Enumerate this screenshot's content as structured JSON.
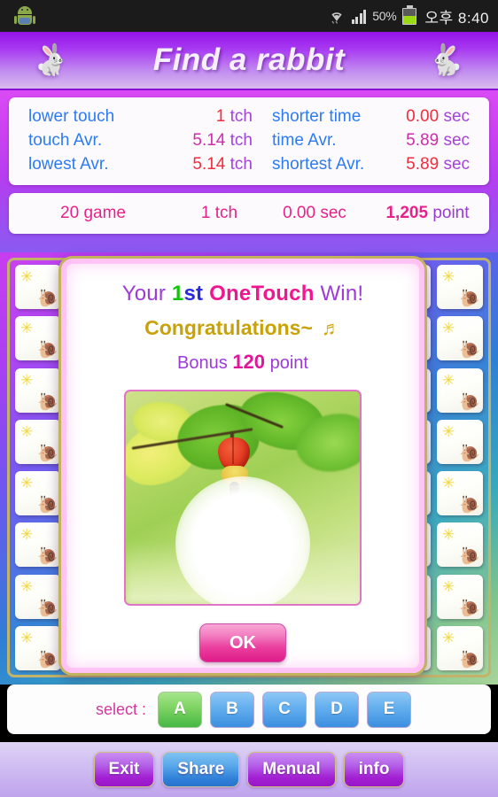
{
  "statusbar": {
    "battery_percent": "50%",
    "clock": "오후 8:40",
    "icons": [
      "android-robot-icon",
      "wifi-icon",
      "signal-bars-icon",
      "battery-icon"
    ]
  },
  "header": {
    "title": "Find a rabbit",
    "left_icon": "rabbit-icon",
    "right_icon": "rabbit-icon"
  },
  "stats": {
    "rows": [
      {
        "label_left": "lower touch",
        "value_left": "1",
        "unit_left": "tch",
        "value_left_color": "#ef2d3c",
        "label_right": "shorter time",
        "value_right": "0.00",
        "unit_right": "sec",
        "value_right_color": "#ef2d3c"
      },
      {
        "label_left": "touch Avr.",
        "value_left": "5.14",
        "unit_left": "tch",
        "value_left_color": "#cd2ea8",
        "label_right": "time Avr.",
        "value_right": "5.89",
        "unit_right": "sec",
        "value_right_color": "#cd2ea8"
      },
      {
        "label_left": "lowest Avr.",
        "value_left": "5.14",
        "unit_left": "tch",
        "value_left_color": "#ef2d3c",
        "label_right": "shortest Avr.",
        "value_right": "5.89",
        "unit_right": "sec",
        "value_right_color": "#ef2d3c"
      }
    ],
    "summary": {
      "games_value": "20",
      "games_unit": "game",
      "touch_value": "1",
      "touch_unit": "tch",
      "time_value": "0.00",
      "time_unit": "sec",
      "point_value": "1,205",
      "point_unit": "point"
    }
  },
  "board": {
    "rows": 8,
    "cols": 9,
    "card_icons": [
      "sun-icon",
      "snail-icon"
    ],
    "sun_glyph": "✳",
    "snail_glyph": "🐌"
  },
  "dialog": {
    "line1": {
      "prefix": "Your ",
      "ordinal_num": "1",
      "ordinal_suffix": "st",
      "highlight": "OneTouch",
      "suffix": " Win!"
    },
    "line2": {
      "text": "Congratulations~",
      "note_glyph": "♬"
    },
    "line3": {
      "prefix": "Bonus",
      "amount": "120",
      "unit": "point"
    },
    "photo_alt": "nature-photo-red-flower-green-leaves",
    "ok_label": "OK"
  },
  "select": {
    "label": "select :",
    "options": [
      {
        "label": "A",
        "selected": true
      },
      {
        "label": "B",
        "selected": false
      },
      {
        "label": "C",
        "selected": false
      },
      {
        "label": "D",
        "selected": false
      },
      {
        "label": "E",
        "selected": false
      }
    ]
  },
  "bottom_buttons": [
    {
      "label": "Exit",
      "style": "purple"
    },
    {
      "label": "Share",
      "style": "blue"
    },
    {
      "label": "Menual",
      "style": "purple"
    },
    {
      "label": "info",
      "style": "purple"
    }
  ],
  "colors": {
    "accent_purple": "#9d3ad8",
    "accent_pink": "#e0159a",
    "accent_blue": "#2d7bf0",
    "accent_red": "#ef2d3c",
    "accent_gold": "#c9a20a",
    "accent_green": "#13c40d"
  }
}
